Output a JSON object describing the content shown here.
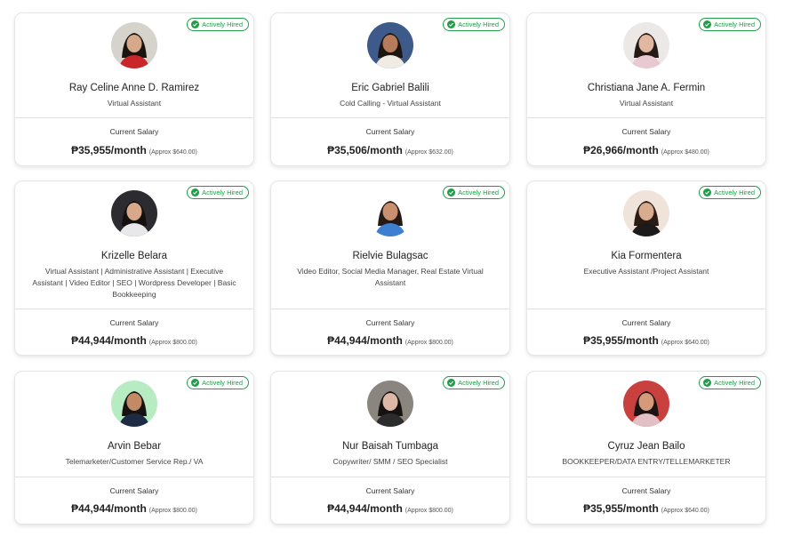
{
  "badge_label": "Actively Hired",
  "salary_label": "Current Salary",
  "colors": {
    "badge": "#1e9e47",
    "border": "#e4e6ea"
  },
  "cards": [
    {
      "name": "Ray Celine Anne D. Ramirez",
      "role": "Virtual Assistant",
      "salary": "₱35,955/month",
      "approx": "(Approx $640.00)",
      "avatar": {
        "bg": "#d6d2cc",
        "skin": "#d7a98b",
        "hair": "#1a1410",
        "shirt": "#c9262a"
      }
    },
    {
      "name": "Eric Gabriel Balili",
      "role": "Cold Calling - Virtual Assistant",
      "salary": "₱35,506/month",
      "approx": "(Approx $632.00)",
      "avatar": {
        "bg": "#3e5a8a",
        "skin": "#b57b5a",
        "hair": "#1c1510",
        "shirt": "#f0ece4"
      }
    },
    {
      "name": "Christiana Jane A. Fermin",
      "role": "Virtual Assistant",
      "salary": "₱26,966/month",
      "approx": "(Approx $480.00)",
      "avatar": {
        "bg": "#ece8e6",
        "skin": "#e2b79f",
        "hair": "#241a16",
        "shirt": "#e9c9d1"
      }
    },
    {
      "name": "Krizelle Belara",
      "role": "Virtual Assistant | Administrative Assistant | Executive Assistant | Video Editor | SEO | Wordpress Developer | Basic Bookkeeping",
      "salary": "₱44,944/month",
      "approx": "(Approx $800.00)",
      "avatar": {
        "bg": "#2b2b30",
        "skin": "#d9a88a",
        "hair": "#14100e",
        "shirt": "#e8e8ea"
      }
    },
    {
      "name": "Rielvie Bulagsac",
      "role": "Video Editor, Social Media Manager, Real Estate Virtual Assistant",
      "salary": "₱44,944/month",
      "approx": "(Approx $800.00)",
      "avatar": {
        "bg": "#ffffff",
        "skin": "#c9906f",
        "hair": "#231915",
        "shirt": "#3d7fd1"
      }
    },
    {
      "name": "Kia Formentera",
      "role": "Executive Assistant /Project Assistant",
      "salary": "₱35,955/month",
      "approx": "(Approx $640.00)",
      "avatar": {
        "bg": "#efe3da",
        "skin": "#d9ab8f",
        "hair": "#2a1c15",
        "shirt": "#1c1a1a"
      }
    },
    {
      "name": "Arvin Bebar",
      "role": "Telemarketer/Customer Service Rep./ VA",
      "salary": "₱44,944/month",
      "approx": "(Approx $800.00)",
      "avatar": {
        "bg": "#b7ecc2",
        "skin": "#c38a66",
        "hair": "#171210",
        "shirt": "#1f2a44"
      }
    },
    {
      "name": "Nur Baisah Tumbaga",
      "role": "Copywriter/ SMM / SEO Specialist",
      "salary": "₱44,944/month",
      "approx": "(Approx $800.00)",
      "avatar": {
        "bg": "#8a857f",
        "skin": "#dcb9a6",
        "hair": "#161211",
        "shirt": "#2c2c2c"
      }
    },
    {
      "name": "Cyruz Jean Bailo",
      "role": "BOOKKEEPER/DATA ENTRY/TELLEMARKETER",
      "salary": "₱35,955/month",
      "approx": "(Approx $640.00)",
      "avatar": {
        "bg": "#c9413f",
        "skin": "#d49a7a",
        "hair": "#1b1311",
        "shirt": "#e3c0c6"
      }
    }
  ]
}
